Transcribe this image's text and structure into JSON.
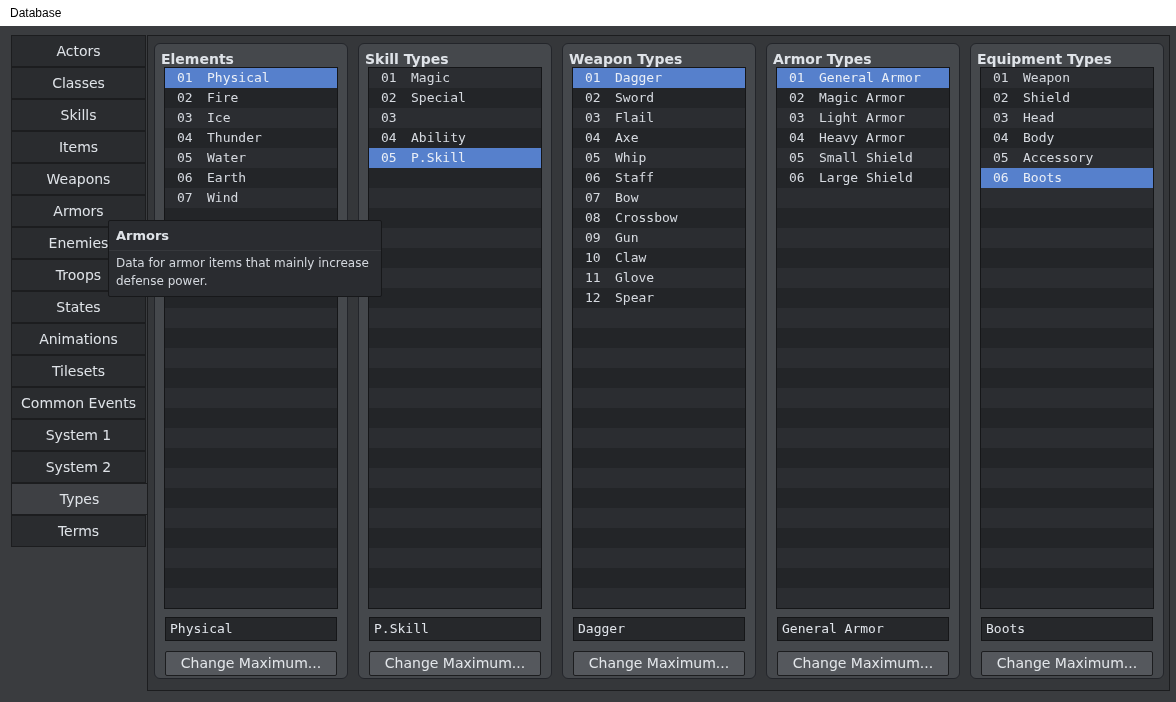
{
  "window": {
    "title": "Database"
  },
  "sidebar": {
    "tabs": [
      {
        "label": "Actors",
        "selected": false
      },
      {
        "label": "Classes",
        "selected": false
      },
      {
        "label": "Skills",
        "selected": false
      },
      {
        "label": "Items",
        "selected": false
      },
      {
        "label": "Weapons",
        "selected": false
      },
      {
        "label": "Armors",
        "selected": false
      },
      {
        "label": "Enemies",
        "selected": false
      },
      {
        "label": "Troops",
        "selected": false
      },
      {
        "label": "States",
        "selected": false
      },
      {
        "label": "Animations",
        "selected": false
      },
      {
        "label": "Tilesets",
        "selected": false
      },
      {
        "label": "Common Events",
        "selected": false
      },
      {
        "label": "System 1",
        "selected": false
      },
      {
        "label": "System 2",
        "selected": false
      },
      {
        "label": "Types",
        "selected": true
      },
      {
        "label": "Terms",
        "selected": false
      }
    ]
  },
  "panels": [
    {
      "title": "Elements",
      "items": [
        {
          "number": "01",
          "name": "Physical",
          "selected": true
        },
        {
          "number": "02",
          "name": "Fire",
          "selected": false
        },
        {
          "number": "03",
          "name": "Ice",
          "selected": false
        },
        {
          "number": "04",
          "name": "Thunder",
          "selected": false
        },
        {
          "number": "05",
          "name": "Water",
          "selected": false
        },
        {
          "number": "06",
          "name": "Earth",
          "selected": false
        },
        {
          "number": "07",
          "name": "Wind",
          "selected": false
        }
      ],
      "name_field": "Physical",
      "button": "Change Maximum..."
    },
    {
      "title": "Skill Types",
      "items": [
        {
          "number": "01",
          "name": "Magic",
          "selected": false
        },
        {
          "number": "02",
          "name": "Special",
          "selected": false
        },
        {
          "number": "03",
          "selected": false
        },
        {
          "number": "04",
          "name": "Ability",
          "selected": false
        },
        {
          "number": "05",
          "name": "P.Skill",
          "selected": true
        }
      ],
      "name_field": "P.Skill",
      "button": "Change Maximum..."
    },
    {
      "title": "Weapon Types",
      "items": [
        {
          "number": "01",
          "name": "Dagger",
          "selected": true
        },
        {
          "number": "02",
          "name": "Sword",
          "selected": false
        },
        {
          "number": "03",
          "name": "Flail",
          "selected": false
        },
        {
          "number": "04",
          "name": "Axe",
          "selected": false
        },
        {
          "number": "05",
          "name": "Whip",
          "selected": false
        },
        {
          "number": "06",
          "name": "Staff",
          "selected": false
        },
        {
          "number": "07",
          "name": "Bow",
          "selected": false
        },
        {
          "number": "08",
          "name": "Crossbow",
          "selected": false
        },
        {
          "number": "09",
          "name": "Gun",
          "selected": false
        },
        {
          "number": "10",
          "name": "Claw",
          "selected": false
        },
        {
          "number": "11",
          "name": "Glove",
          "selected": false
        },
        {
          "number": "12",
          "name": "Spear",
          "selected": false
        }
      ],
      "name_field": "Dagger",
      "button": "Change Maximum..."
    },
    {
      "title": "Armor Types",
      "items": [
        {
          "number": "01",
          "name": "General Armor",
          "selected": true
        },
        {
          "number": "02",
          "name": "Magic Armor",
          "selected": false
        },
        {
          "number": "03",
          "name": "Light Armor",
          "selected": false
        },
        {
          "number": "04",
          "name": "Heavy Armor",
          "selected": false
        },
        {
          "number": "05",
          "name": "Small Shield",
          "selected": false
        },
        {
          "number": "06",
          "name": "Large Shield",
          "selected": false
        }
      ],
      "name_field": "General Armor",
      "button": "Change Maximum..."
    },
    {
      "title": "Equipment Types",
      "items": [
        {
          "number": "01",
          "name": "Weapon",
          "selected": false
        },
        {
          "number": "02",
          "name": "Shield",
          "selected": false
        },
        {
          "number": "03",
          "name": "Head",
          "selected": false
        },
        {
          "number": "04",
          "name": "Body",
          "selected": false
        },
        {
          "number": "05",
          "name": "Accessory",
          "selected": false
        },
        {
          "number": "06",
          "name": "Boots",
          "selected": true
        }
      ],
      "name_field": "Boots",
      "button": "Change Maximum..."
    }
  ],
  "tooltip": {
    "title": "Armors",
    "text": "Data for armor items that mainly increase defense power."
  }
}
